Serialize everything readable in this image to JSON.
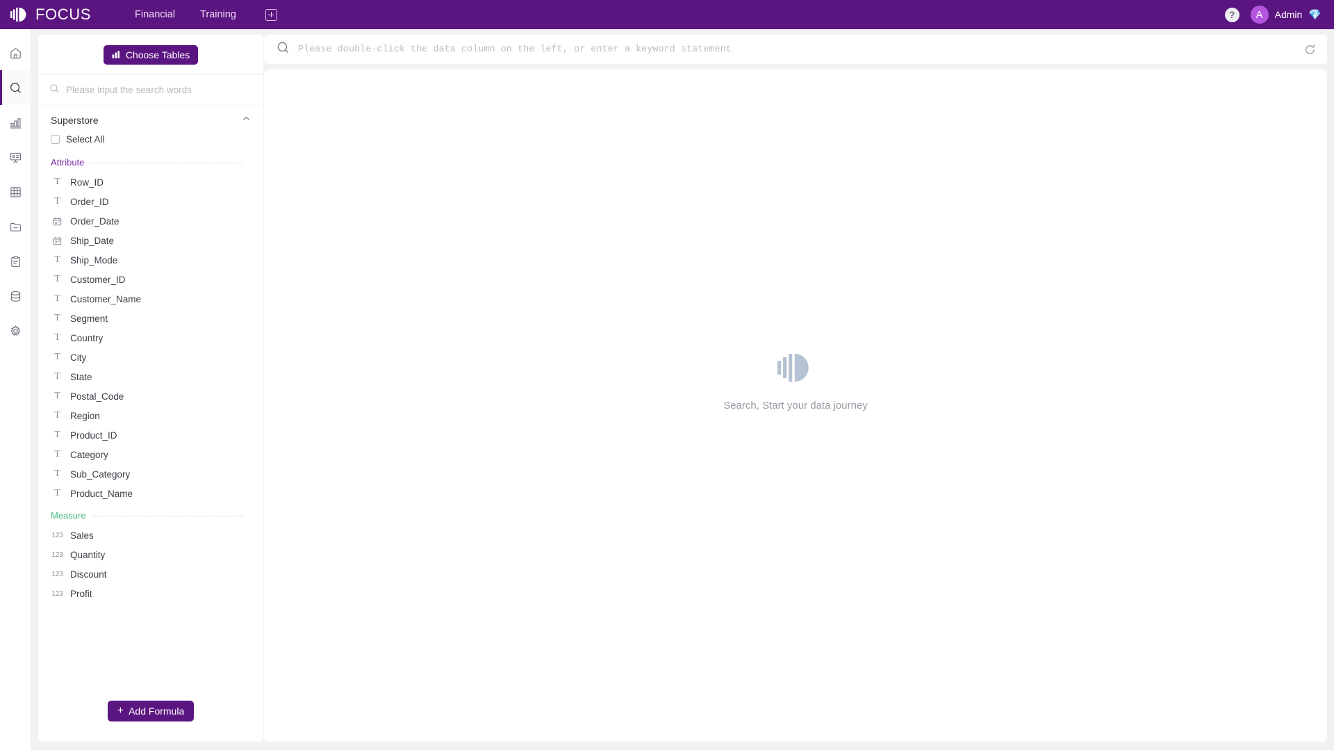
{
  "header": {
    "brand": "FOCUS",
    "brand_logo_icon": "focus-logo-icon",
    "tabs": [
      {
        "label": "Financial"
      },
      {
        "label": "Training"
      }
    ],
    "add_tab_icon": "plus-square-icon",
    "help_icon": "question-mark-icon",
    "help_label": "?",
    "avatar_initial": "A",
    "user_name": "Admin",
    "gem_icon": "diamond-icon",
    "gem_glyph": "💎"
  },
  "rail": {
    "items": [
      {
        "name": "home",
        "icon": "home-icon",
        "active": false
      },
      {
        "name": "search",
        "icon": "search-icon",
        "active": true
      },
      {
        "name": "analytics",
        "icon": "bar-chart-icon",
        "active": false
      },
      {
        "name": "dashboard",
        "icon": "presentation-icon",
        "active": false
      },
      {
        "name": "tables",
        "icon": "grid-table-icon",
        "active": false
      },
      {
        "name": "folder",
        "icon": "folder-minus-icon",
        "active": false
      },
      {
        "name": "reports",
        "icon": "clipboard-icon",
        "active": false
      },
      {
        "name": "datasource",
        "icon": "database-icon",
        "active": false
      },
      {
        "name": "settings",
        "icon": "gear-icon",
        "active": false
      }
    ]
  },
  "panel": {
    "choose_tables_label": "Choose Tables",
    "choose_tables_icon": "bar-chart-small-icon",
    "search_placeholder": "Please input the search words",
    "search_value": "",
    "search_icon": "search-icon",
    "table_name": "Superstore",
    "collapse_icon": "chevron-up-icon",
    "select_all_label": "Select All",
    "select_all_checked": false,
    "groups": [
      {
        "label": "Attribute",
        "color": "#7a2aa8",
        "fields": [
          {
            "label": "Row_ID",
            "type": "text",
            "icon": "text-field-icon"
          },
          {
            "label": "Order_ID",
            "type": "text",
            "icon": "text-field-icon"
          },
          {
            "label": "Order_Date",
            "type": "date",
            "icon": "calendar-icon"
          },
          {
            "label": "Ship_Date",
            "type": "date",
            "icon": "calendar-icon"
          },
          {
            "label": "Ship_Mode",
            "type": "text",
            "icon": "text-field-icon"
          },
          {
            "label": "Customer_ID",
            "type": "text",
            "icon": "text-field-icon"
          },
          {
            "label": "Customer_Name",
            "type": "text",
            "icon": "text-field-icon"
          },
          {
            "label": "Segment",
            "type": "text",
            "icon": "text-field-icon"
          },
          {
            "label": "Country",
            "type": "text",
            "icon": "text-field-icon"
          },
          {
            "label": "City",
            "type": "text",
            "icon": "text-field-icon"
          },
          {
            "label": "State",
            "type": "text",
            "icon": "text-field-icon"
          },
          {
            "label": "Postal_Code",
            "type": "text",
            "icon": "text-field-icon"
          },
          {
            "label": "Region",
            "type": "text",
            "icon": "text-field-icon"
          },
          {
            "label": "Product_ID",
            "type": "text",
            "icon": "text-field-icon"
          },
          {
            "label": "Category",
            "type": "text",
            "icon": "text-field-icon"
          },
          {
            "label": "Sub_Category",
            "type": "text",
            "icon": "text-field-icon"
          },
          {
            "label": "Product_Name",
            "type": "text",
            "icon": "text-field-icon"
          }
        ]
      },
      {
        "label": "Measure",
        "color": "#46b87a",
        "fields": [
          {
            "label": "Sales",
            "type": "number",
            "icon": "number-field-icon"
          },
          {
            "label": "Quantity",
            "type": "number",
            "icon": "number-field-icon"
          },
          {
            "label": "Discount",
            "type": "number",
            "icon": "number-field-icon"
          },
          {
            "label": "Profit",
            "type": "number",
            "icon": "number-field-icon"
          }
        ]
      }
    ],
    "add_formula_label": "Add Formula",
    "add_formula_plus": "+"
  },
  "main": {
    "search_placeholder": "Please double-click the data column on the left, or enter a keyword statement",
    "search_value": "",
    "search_icon": "search-icon",
    "refresh_icon": "refresh-icon",
    "empty_state_icon": "focus-logo-icon",
    "empty_state_text": "Search, Start your data journey"
  },
  "colors": {
    "brand_purple": "#5b1580",
    "accent_purple": "#7a2aa8",
    "measure_green": "#46b87a",
    "avatar_magenta": "#b455e0",
    "page_background": "#f2f2f4",
    "panel_white": "#ffffff",
    "muted_text": "#9a9aa6"
  }
}
